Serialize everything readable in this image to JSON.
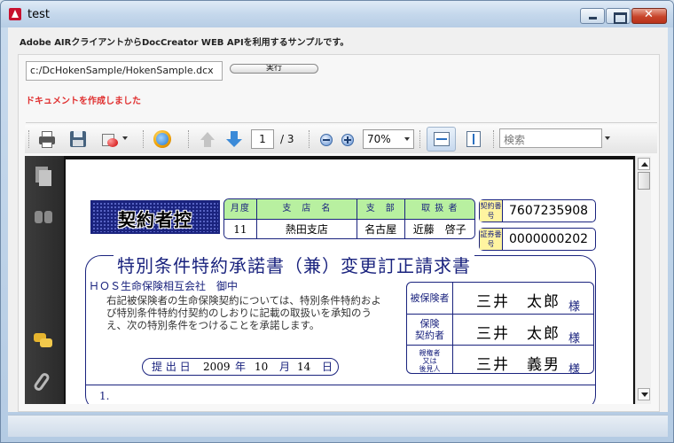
{
  "window": {
    "title": "test"
  },
  "header": {
    "description": "Adobe AIRクライアントからDocCreator WEB APIを利用するサンプルです。"
  },
  "form": {
    "path_value": "c:/DcHokenSample/HokenSample.dcx",
    "execute_label": "実行",
    "status_message": "ドキュメントを作成しました"
  },
  "toolbar": {
    "current_page": "1",
    "page_total": "/ 3",
    "zoom": "70%",
    "search_placeholder": "検索"
  },
  "document": {
    "stamp": "契約者控",
    "branch_table": {
      "headers": [
        "月度",
        "支　店　名",
        "支　部",
        "取 扱 者"
      ],
      "values": [
        "11",
        "熱田支店",
        "名古屋",
        "近藤　啓子"
      ]
    },
    "contract_label": "契約番号",
    "contract_number": "7607235908",
    "certificate_label": "証券番号",
    "certificate_number": "0000000202",
    "title": "特別条件特約承諾書（兼）変更訂正請求書",
    "company": "ＨＯＳ生命保険相互会社　御中",
    "consent_text": "右記被保険者の生命保険契約については、特別条件特約および特別条件特約付契約のしおりに記載の取扱いを承知のうえ、次の特別条件をつけることを承諾します。",
    "date": {
      "label": "提 出 日",
      "year": "2009",
      "year_unit": "年",
      "month": "10",
      "month_unit": "月",
      "day": "14",
      "day_unit": "日"
    },
    "parties": [
      {
        "label": "被保険者",
        "name": "三井　太郎",
        "honorific": "様"
      },
      {
        "label": "保険\n契約者",
        "name": "三井　太郎",
        "honorific": "様"
      },
      {
        "label": "親権者\n又は\n後見人",
        "name": "三井　義男",
        "honorific": "様"
      }
    ],
    "item_number": "1."
  }
}
